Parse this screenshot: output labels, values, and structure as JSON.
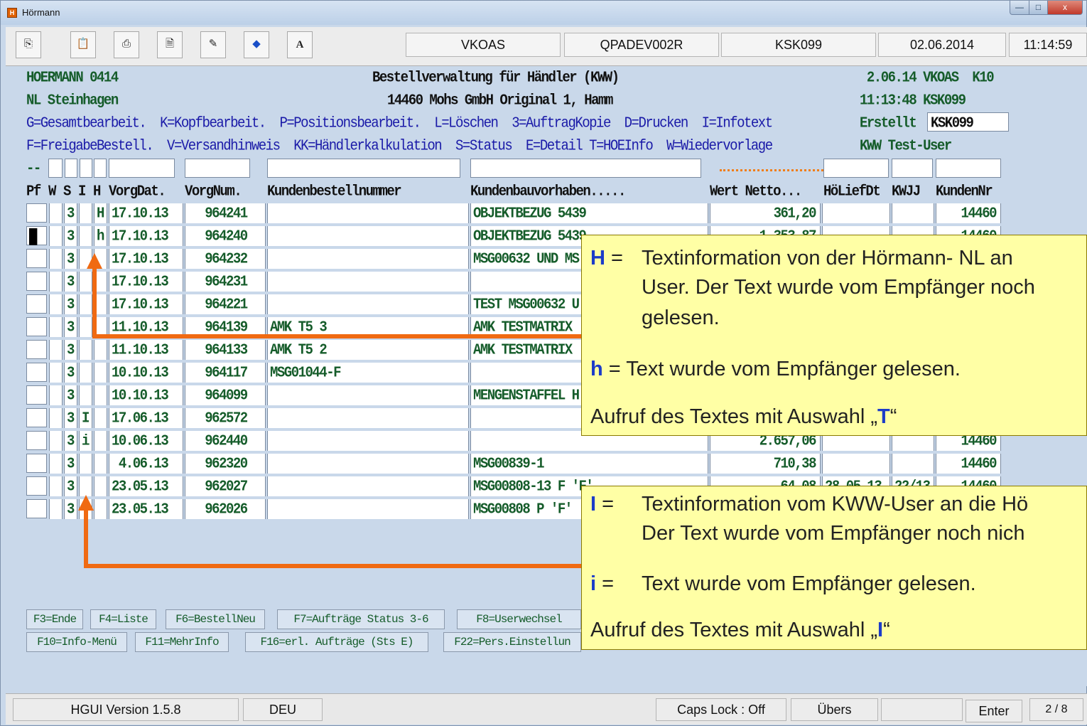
{
  "window": {
    "title": "Hörmann",
    "buttons": {
      "minimize": "—",
      "maximize": "□",
      "close": "x"
    }
  },
  "toolbar": {
    "icons": [
      "copy-icon",
      "paste-icon",
      "print-icon",
      "print-preview-icon",
      "printer-settings-icon",
      "help-icon",
      "font-icon"
    ],
    "font_label": "A",
    "fields": [
      "VKOAS",
      "QPADEV002R",
      "KSK099",
      "02.06.2014",
      "11:14:59"
    ]
  },
  "header": {
    "company": "HOERMANN 0414",
    "title": "Bestellverwaltung für Händler (KWW)",
    "date_user": " 2.06.14 VKOAS  K10",
    "branch": "NL Steinhagen",
    "customer": "14460 Mohs GmbH Original 1, Hamm",
    "time_user": "11:13:48 KSK099",
    "options1": "G=Gesamtbearbeit.  K=Kopfbearbeit.  P=Positionsbearbeit.  L=Löschen  3=AuftragKopie  D=Drucken  I=Infotext",
    "options2": "F=FreigabeBestell.  V=Versandhinweis  KK=Händlerkalkulation  S=Status  E=Detail T=HOEInfo  W=Wiedervorlage",
    "created_label": "Erstellt",
    "created_value": "KSK099",
    "user_label": "KWW Test-User",
    "filter_prefix": "--"
  },
  "table": {
    "headers": [
      "Pf",
      "W",
      "S",
      "I",
      "H",
      "VorgDat.",
      "VorgNum.",
      "Kundenbestellnummer",
      "Kundenbauvorhaben.....",
      "Wert Netto...",
      "HöLiefDt",
      "KWJJ",
      "KundenNr"
    ],
    "rows": [
      {
        "pf": "",
        "w": "",
        "s": "3",
        "i": "",
        "h": "H",
        "date": "17.10.13",
        "num": "964241",
        "order": "",
        "project": "OBJEKTBEZUG 5439",
        "value": "361,20",
        "deliv": "",
        "kwjj": "",
        "cust": "14460"
      },
      {
        "pf": "█",
        "w": "",
        "s": "3",
        "i": "",
        "h": "h",
        "date": "17.10.13",
        "num": "964240",
        "order": "",
        "project": "OBJEKTBEZUG 5439",
        "value": "1.353,87",
        "deliv": "",
        "kwjj": "",
        "cust": "14460"
      },
      {
        "pf": "",
        "w": "",
        "s": "3",
        "i": "",
        "h": "",
        "date": "17.10.13",
        "num": "964232",
        "order": "",
        "project": "MSG00632 UND MS",
        "value": "",
        "deliv": "",
        "kwjj": "",
        "cust": ""
      },
      {
        "pf": "",
        "w": "",
        "s": "3",
        "i": "",
        "h": "",
        "date": "17.10.13",
        "num": "964231",
        "order": "",
        "project": "",
        "value": "",
        "deliv": "",
        "kwjj": "",
        "cust": ""
      },
      {
        "pf": "",
        "w": "",
        "s": "3",
        "i": "",
        "h": "",
        "date": "17.10.13",
        "num": "964221",
        "order": "",
        "project": "TEST MSG00632 U",
        "value": "",
        "deliv": "",
        "kwjj": "",
        "cust": ""
      },
      {
        "pf": "",
        "w": "",
        "s": "3",
        "i": "",
        "h": "",
        "date": "11.10.13",
        "num": "964139",
        "order": "AMK T5 3",
        "project": "AMK TESTMATRIX",
        "value": "",
        "deliv": "",
        "kwjj": "",
        "cust": ""
      },
      {
        "pf": "",
        "w": "",
        "s": "3",
        "i": "",
        "h": "",
        "date": "11.10.13",
        "num": "964133",
        "order": "AMK T5 2",
        "project": "AMK TESTMATRIX",
        "value": "",
        "deliv": "",
        "kwjj": "",
        "cust": ""
      },
      {
        "pf": "",
        "w": "",
        "s": "3",
        "i": "",
        "h": "",
        "date": "10.10.13",
        "num": "964117",
        "order": "MSG01044-F",
        "project": "",
        "value": "",
        "deliv": "",
        "kwjj": "",
        "cust": ""
      },
      {
        "pf": "",
        "w": "",
        "s": "3",
        "i": "",
        "h": "",
        "date": "10.10.13",
        "num": "964099",
        "order": "",
        "project": "MENGENSTAFFEL H",
        "value": "",
        "deliv": "",
        "kwjj": "",
        "cust": ""
      },
      {
        "pf": "",
        "w": "",
        "s": "3",
        "i": "I",
        "h": "",
        "date": "17.06.13",
        "num": "962572",
        "order": "",
        "project": "",
        "value": "",
        "deliv": "",
        "kwjj": "",
        "cust": ""
      },
      {
        "pf": "",
        "w": "",
        "s": "3",
        "i": "i",
        "h": "",
        "date": "10.06.13",
        "num": "962440",
        "order": "",
        "project": "",
        "value": "2.657,06",
        "deliv": "",
        "kwjj": "",
        "cust": "14460"
      },
      {
        "pf": "",
        "w": "",
        "s": "3",
        "i": "",
        "h": "",
        "date": " 4.06.13",
        "num": "962320",
        "order": "",
        "project": "MSG00839-1",
        "value": "710,38",
        "deliv": "",
        "kwjj": "",
        "cust": "14460"
      },
      {
        "pf": "",
        "w": "",
        "s": "3",
        "i": "",
        "h": "",
        "date": "23.05.13",
        "num": "962027",
        "order": "",
        "project": "MSG00808-13 F 'F'",
        "value": "64,08",
        "deliv": "28.05.13",
        "kwjj": "22/13",
        "cust": "14460"
      },
      {
        "pf": "",
        "w": "",
        "s": "3",
        "i": "",
        "h": "",
        "date": "23.05.13",
        "num": "962026",
        "order": "",
        "project": "MSG00808 P 'F'",
        "value": "",
        "deliv": "",
        "kwjj": "",
        "cust": ""
      }
    ]
  },
  "fkeys": {
    "row1": [
      "F3=Ende",
      "F4=Liste",
      "F6=BestellNeu",
      "F7=Aufträge Status 3-6",
      "F8=Userwechsel"
    ],
    "row2": [
      "F10=Info-Menü",
      "F11=MehrInfo",
      "F16=erl. Aufträge (Sts E)",
      "F22=Pers.Einstellun"
    ]
  },
  "statusbar": [
    "HGUI Version 1.5.8",
    "DEU",
    "Caps Lock : Off",
    "Übers",
    "",
    "Enter",
    "2 / 8"
  ],
  "callout_h": {
    "key_upper": "H",
    "eq": " =",
    "line1": "Textinformation von der Hörmann- NL an",
    "line2": "User. Der Text wurde vom Empfänger noch",
    "line3": "gelesen.",
    "key_lower": "h",
    "line4": " = Text wurde vom Empfänger gelesen.",
    "line5_pre": "Aufruf des Textes mit Auswahl „",
    "line5_key": "T",
    "line5_post": "“"
  },
  "callout_i": {
    "key_upper": "I",
    "eq": " =",
    "line1": "Textinformation vom KWW-User an die Hö",
    "line2": "Der Text wurde vom Empfänger noch nich",
    "key_lower": "i",
    "eq2": " =",
    "line3": "Text wurde vom Empfänger gelesen.",
    "line4_pre": "Aufruf des Textes mit Auswahl „",
    "line4_key": "I",
    "line4_post": "“"
  },
  "colors": {
    "terminal_bg": "#c9d8ea",
    "terminal_text": "#0b6b2c",
    "option_text": "#1a1aa8",
    "callout_bg": "#ffffa5",
    "arrow": "#f06a12"
  }
}
